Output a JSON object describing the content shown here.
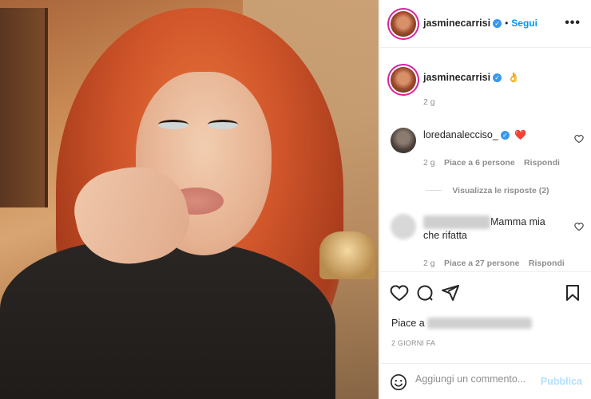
{
  "post": {
    "author": "jasminecarrisi",
    "follow_label": "Segui",
    "dot": "•",
    "more_label": "•••",
    "caption_emoji": "👌",
    "caption_time": "2 g"
  },
  "comments": [
    {
      "username": "loredanalecciso_",
      "text": "❤️",
      "time": "2 g",
      "likes": "Piace a 6 persone",
      "reply_label": "Rispondi",
      "view_replies": "Visualizza le risposte (2)"
    },
    {
      "username": "",
      "text": "Mamma mia che rifatta",
      "time": "2 g",
      "likes": "Piace a 27 persone",
      "reply_label": "Rispondi"
    }
  ],
  "actions": {
    "likes_prefix": "Piace a",
    "posted_ago": "2 GIORNI FA"
  },
  "comment_box": {
    "placeholder": "Aggiungi un commento...",
    "publish_label": "Pubblica"
  },
  "colors": {
    "accent": "#0095f6",
    "verified": "#3897f0",
    "heart_red": "#ed4956"
  }
}
